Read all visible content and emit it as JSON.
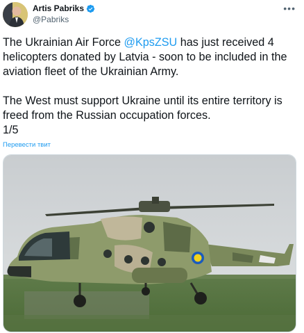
{
  "author": {
    "display_name": "Artis Pabriks",
    "handle": "@Pabriks",
    "verified": true,
    "avatar_icon": "person-avatar-icon"
  },
  "tweet": {
    "text_before_mention": "The Ukrainian Air Force ",
    "mention": "@KpsZSU",
    "text_after_mention": " has just received 4 helicopters donated by Latvia - soon to be included in the aviation fleet of the Ukrainian Army.\n\nThe West must support Ukraine until its entire territory is freed from the Russian occupation forces.\n1/5",
    "translate_label": "Перевести твит"
  },
  "media": {
    "description_icon": "helicopter-photo",
    "alt": ""
  },
  "colors": {
    "accent": "#1d9bf0",
    "text": "#0f1419",
    "muted": "#536471"
  }
}
